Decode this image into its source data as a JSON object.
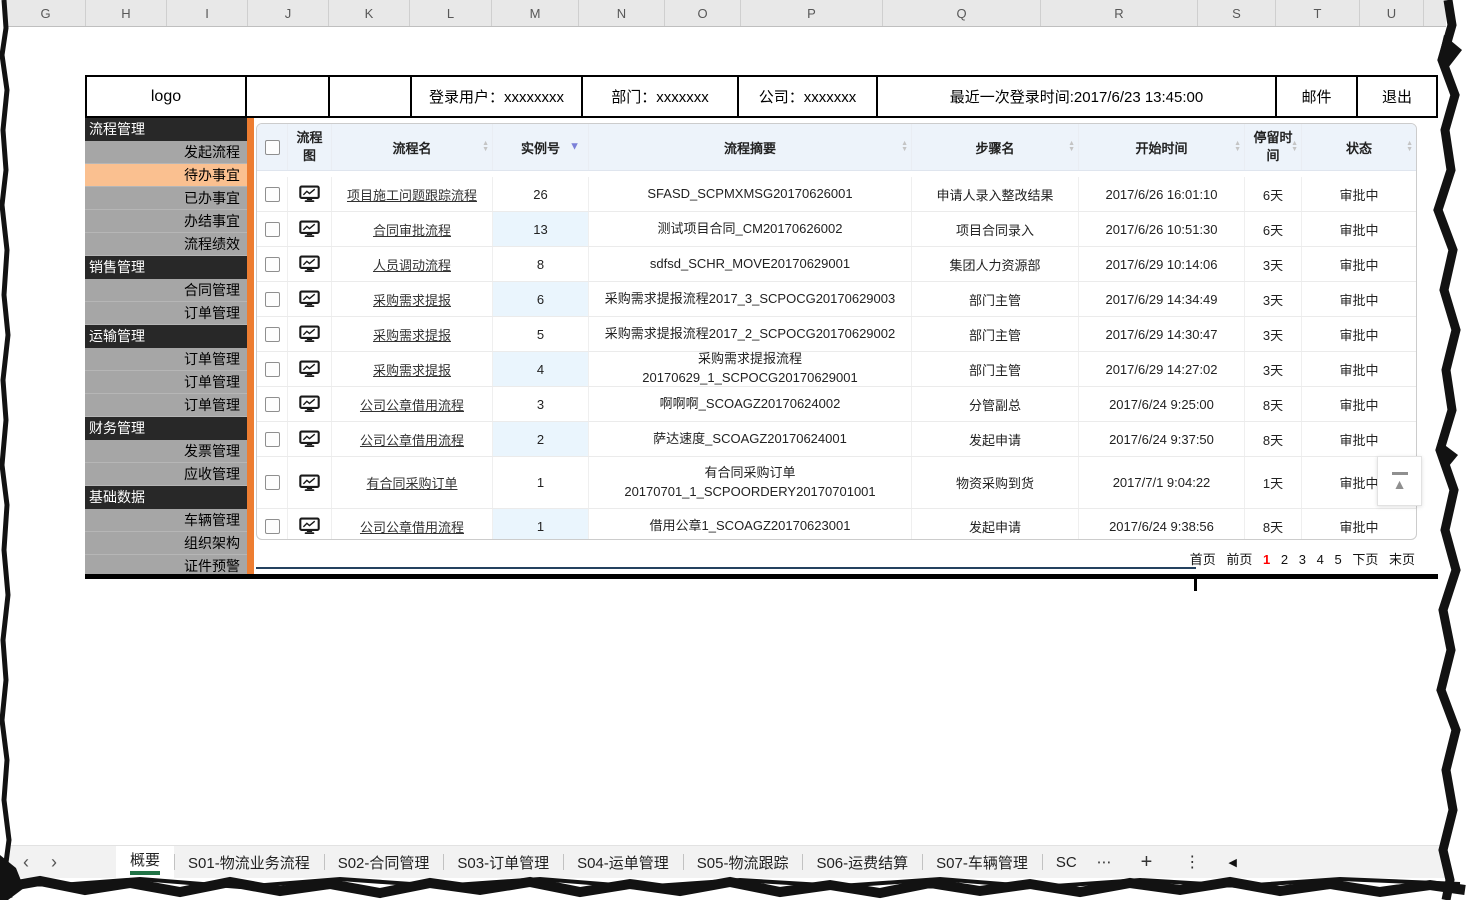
{
  "colors": {
    "accent_orange": "#ED7D31",
    "selected_sidebar_item": "#FAC090",
    "sidebar_item_bg": "#A6A6A6",
    "sidebar_header_bg": "#282828",
    "table_header_bg": "#EDF3FA",
    "id_column_tint": "#EAF5FD",
    "active_page_number": "#FF0000",
    "active_sheet_tab_underline": "#217346",
    "active_sort_icon": "#7B80D8"
  },
  "spreadsheet": {
    "column_letters": [
      "G",
      "H",
      "I",
      "J",
      "K",
      "L",
      "M",
      "N",
      "O",
      "P",
      "Q",
      "R",
      "S",
      "T",
      "U"
    ]
  },
  "app_header": {
    "logo": "logo",
    "login_user": "登录用户：xxxxxxxx",
    "department": "部门：xxxxxxx",
    "company": "公司：xxxxxxx",
    "last_login": "最近一次登录时间:2017/6/23  13:45:00",
    "mail": "邮件",
    "logout": "退出"
  },
  "sidebar": {
    "sections": [
      {
        "title": "流程管理",
        "items": [
          "发起流程",
          "待办事宜",
          "已办事宜",
          "办结事宜",
          "流程绩效"
        ]
      },
      {
        "title": "销售管理",
        "items": [
          "合同管理",
          "订单管理"
        ]
      },
      {
        "title": "运输管理",
        "items": [
          "订单管理",
          "订单管理",
          "订单管理"
        ]
      },
      {
        "title": "财务管理",
        "items": [
          "发票管理",
          "应收管理"
        ]
      },
      {
        "title": "基础数据",
        "items": [
          "车辆管理",
          "组织架构",
          "证件预警"
        ]
      }
    ],
    "selected_item": "待办事宜"
  },
  "table": {
    "headers": {
      "diagram": "流程图",
      "name": "流程名",
      "id": "实例号",
      "summary": "流程摘要",
      "step": "步骤名",
      "start": "开始时间",
      "stay": "停留时间",
      "status": "状态"
    },
    "sort_icons": {
      "up": "▲",
      "down": "▼"
    },
    "icons": {
      "process_diagram": "monitor-chart-icon"
    },
    "rows": [
      {
        "name": "项目施工问题跟踪流程",
        "id": "26",
        "summary": "SFASD_SCPMXMSG20170626001",
        "step": "申请人录入整改结果",
        "start": "2017/6/26 16:01:10",
        "stay": "6天",
        "status": "审批中"
      },
      {
        "name": "合同审批流程",
        "id": "13",
        "summary": "测试项目合同_CM20170626002",
        "step": "项目合同录入",
        "start": "2017/6/26 10:51:30",
        "stay": "6天",
        "status": "审批中"
      },
      {
        "name": "人员调动流程",
        "id": "8",
        "summary": "sdfsd_SCHR_MOVE20170629001",
        "step": "集团人力资源部",
        "start": "2017/6/29 10:14:06",
        "stay": "3天",
        "status": "审批中"
      },
      {
        "name": "采购需求提报",
        "id": "6",
        "summary": "采购需求提报流程2017_3_SCPOCG20170629003",
        "step": "部门主管",
        "start": "2017/6/29 14:34:49",
        "stay": "3天",
        "status": "审批中"
      },
      {
        "name": "采购需求提报",
        "id": "5",
        "summary": "采购需求提报流程2017_2_SCPOCG20170629002",
        "step": "部门主管",
        "start": "2017/6/29 14:30:47",
        "stay": "3天",
        "status": "审批中"
      },
      {
        "name": "采购需求提报",
        "id": "4",
        "summary": "采购需求提报流程20170629_1_SCPOCG20170629001",
        "step": "部门主管",
        "start": "2017/6/29 14:27:02",
        "stay": "3天",
        "status": "审批中"
      },
      {
        "name": "公司公章借用流程",
        "id": "3",
        "summary": "啊啊啊_SCOAGZ20170624002",
        "step": "分管副总",
        "start": "2017/6/24 9:25:00",
        "stay": "8天",
        "status": "审批中"
      },
      {
        "name": "公司公章借用流程",
        "id": "2",
        "summary": "萨达速度_SCOAGZ20170624001",
        "step": "发起申请",
        "start": "2017/6/24 9:37:50",
        "stay": "8天",
        "status": "审批中"
      },
      {
        "name": "有合同采购订单",
        "id": "1",
        "summary": "有合同采购订单20170701_1_SCPOORDERY20170701001",
        "step": "物资采购到货",
        "start": "2017/7/1 9:04:22",
        "stay": "1天",
        "status": "审批中"
      },
      {
        "name": "公司公章借用流程",
        "id": "1",
        "summary": "借用公章1_SCOAGZ20170623001",
        "step": "发起申请",
        "start": "2017/6/24 9:38:56",
        "stay": "8天",
        "status": "审批中"
      }
    ]
  },
  "pagination": {
    "first": "首页",
    "prev": "前页",
    "pages": [
      "1",
      "2",
      "3",
      "4",
      "5"
    ],
    "current": "1",
    "next": "下页",
    "last": "末页"
  },
  "floating": {
    "back_to_top_icon": "▲"
  },
  "sheet_bar": {
    "nav_prev": "‹",
    "nav_next": "›",
    "tabs": [
      "概要",
      "S01-物流业务流程",
      "S02-合同管理",
      "S03-订单管理",
      "S04-运单管理",
      "S05-物流跟踪",
      "S06-运费结算",
      "S07-车辆管理",
      "SC"
    ],
    "active_tab": "概要",
    "more_icon": "⋯",
    "add_icon": "+",
    "menu_icon": "⋮",
    "scroll_icon": "◀"
  }
}
